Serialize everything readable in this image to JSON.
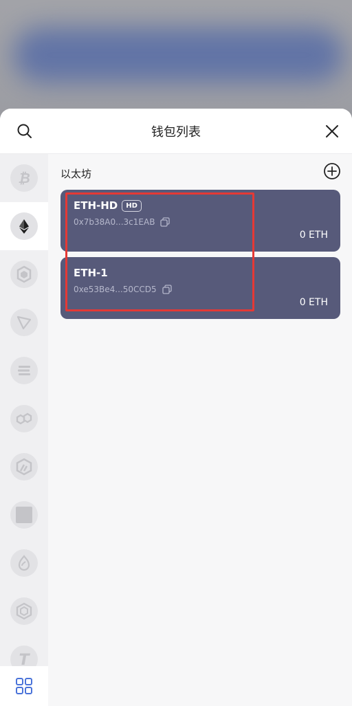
{
  "header": {
    "title": "钱包列表"
  },
  "section": {
    "title": "以太坊"
  },
  "wallets": [
    {
      "name": "ETH-HD",
      "badge": "HD",
      "address": "0x7b38A0...3c1EAB",
      "balance": "0 ETH"
    },
    {
      "name": "ETH-1",
      "badge": "",
      "address": "0xe53Be4...50CCD5",
      "balance": "0 ETH"
    }
  ],
  "chains": [
    {
      "name": "bitcoin",
      "icon": "bitcoin-icon"
    },
    {
      "name": "ethereum",
      "icon": "ethereum-icon",
      "active": true
    },
    {
      "name": "bnb",
      "icon": "bnb-icon"
    },
    {
      "name": "tron",
      "icon": "tron-icon"
    },
    {
      "name": "solana",
      "icon": "solana-icon"
    },
    {
      "name": "polygon",
      "icon": "polygon-icon"
    },
    {
      "name": "arbitrum",
      "icon": "arbitrum-icon"
    },
    {
      "name": "square-chain",
      "icon": "square-icon"
    },
    {
      "name": "sui",
      "icon": "sui-icon"
    },
    {
      "name": "cube-chain",
      "icon": "cube-icon"
    },
    {
      "name": "t-chain",
      "icon": "t-icon"
    }
  ],
  "colors": {
    "card": "#575a7a",
    "highlight": "#e53935",
    "sheet": "#f7f7f8",
    "sidebar": "#f0f0f2"
  }
}
